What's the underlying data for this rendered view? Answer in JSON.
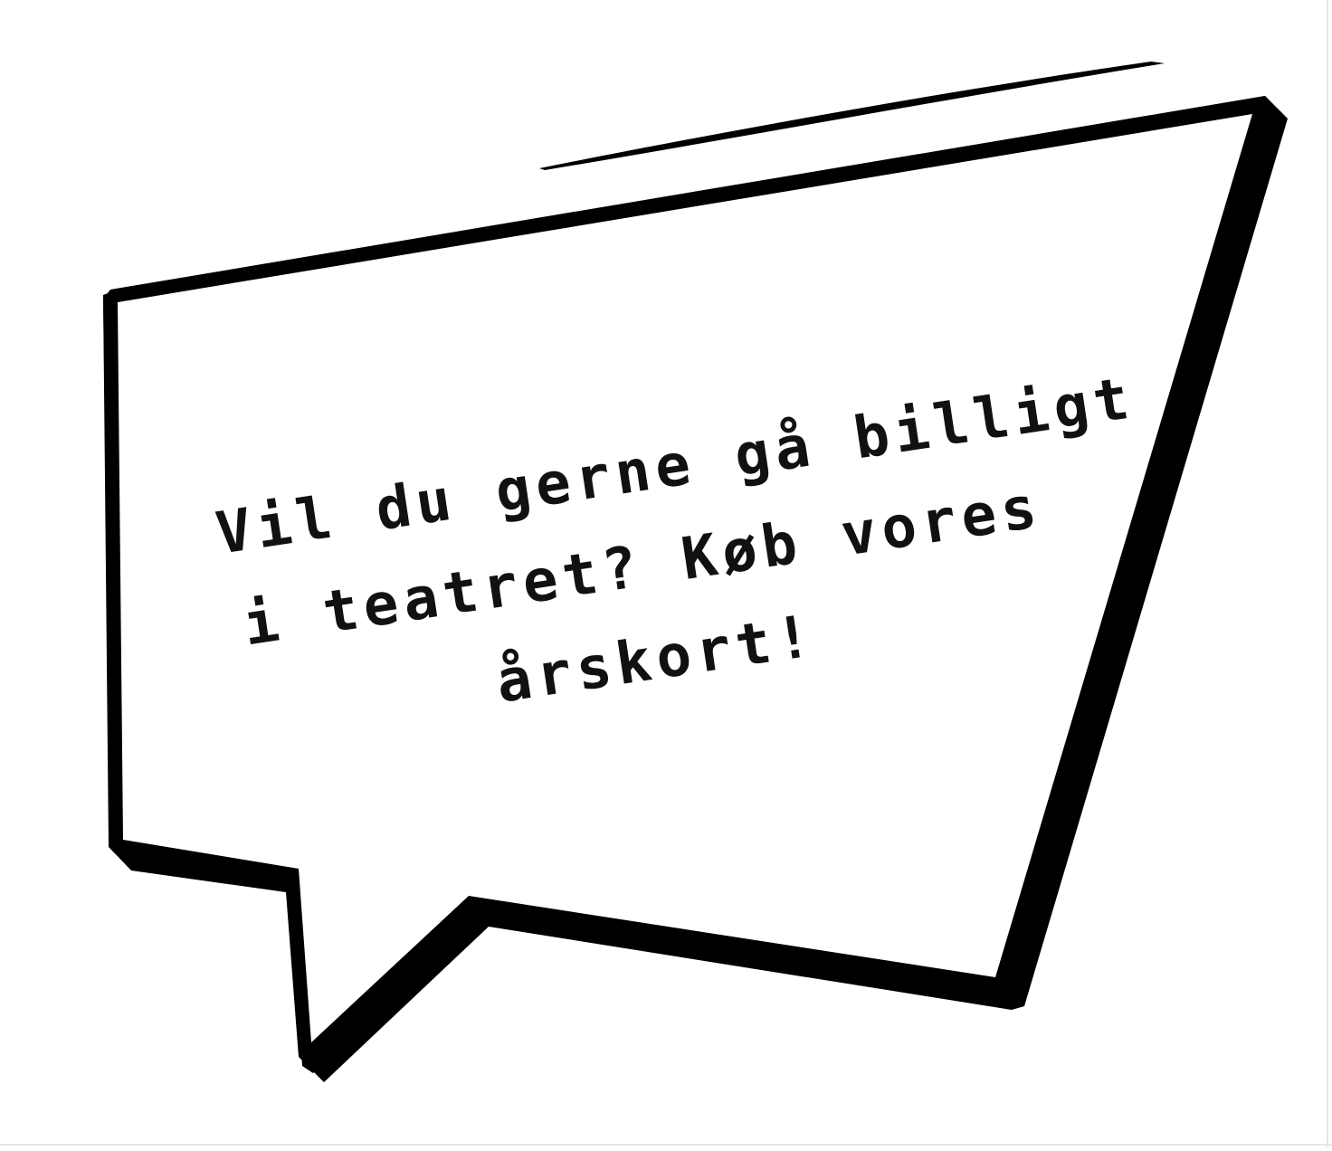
{
  "speech_bubble": {
    "lines": [
      "Vil du gerne gå billigt",
      "i teatret? Køb vores",
      "årskort!"
    ]
  },
  "colors": {
    "background": "#ffffff",
    "ink": "#000000",
    "text": "#111111"
  }
}
